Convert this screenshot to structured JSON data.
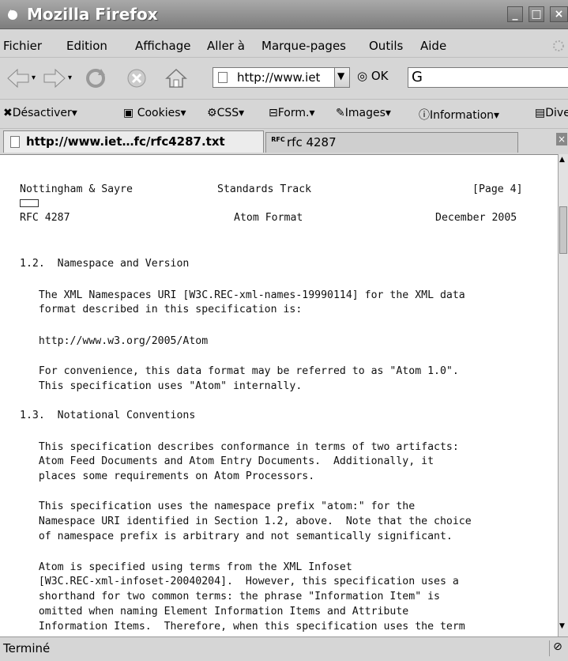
{
  "window": {
    "title": "Mozilla Firefox",
    "buttons": {
      "minimize": "_",
      "maximize": "□",
      "close": "×"
    }
  },
  "menu": [
    "Fichier",
    "Edition",
    "Affichage",
    "Aller à",
    "Marque-pages",
    "Outils",
    "Aide"
  ],
  "toolbar": {
    "url": "http://www.iet",
    "ok_label": "OK",
    "search_value": "G"
  },
  "devbar": [
    "Désactiver",
    "Cookies",
    "CSS",
    "Form.",
    "Images",
    "Information",
    "Dive"
  ],
  "tabs": [
    {
      "label": "http://www.iet…fc/rfc4287.txt"
    },
    {
      "label": "rfc 4287",
      "icon_text": "RFC"
    }
  ],
  "document": {
    "footer_left": "Nottingham & Sayre",
    "footer_center": "Standards Track",
    "footer_right": "[Page 4]",
    "header_left": "RFC 4287",
    "header_center": "Atom Format",
    "header_right": "December 2005",
    "lines": [
      "1.2.  Namespace and Version",
      "   The XML Namespaces URI [W3C.REC-xml-names-19990114] for the XML data",
      "   format described in this specification is:",
      "   http://www.w3.org/2005/Atom",
      "   For convenience, this data format may be referred to as \"Atom 1.0\".",
      "   This specification uses \"Atom\" internally.",
      "1.3.  Notational Conventions",
      "   This specification describes conformance in terms of two artifacts:",
      "   Atom Feed Documents and Atom Entry Documents.  Additionally, it",
      "   places some requirements on Atom Processors.",
      "   This specification uses the namespace prefix \"atom:\" for the",
      "   Namespace URI identified in Section 1.2, above.  Note that the choice",
      "   of namespace prefix is arbitrary and not semantically significant.",
      "   Atom is specified using terms from the XML Infoset",
      "   [W3C.REC-xml-infoset-20040204].  However, this specification uses a",
      "   shorthand for two common terms: the phrase \"Information Item\" is",
      "   omitted when naming Element Information Items and Attribute",
      "   Information Items.  Therefore, when this specification uses the term"
    ]
  },
  "status": {
    "text": "Terminé"
  }
}
